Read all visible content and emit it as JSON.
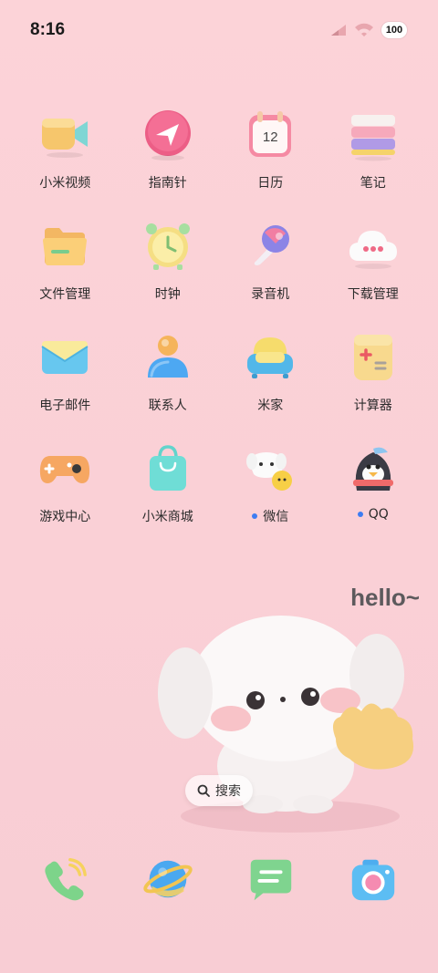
{
  "status": {
    "time": "8:16",
    "battery": "100"
  },
  "apps": [
    {
      "label": "小米视频",
      "icon": "video-icon"
    },
    {
      "label": "指南针",
      "icon": "compass-icon"
    },
    {
      "label": "日历",
      "icon": "calendar-icon",
      "calendar_day": "12"
    },
    {
      "label": "笔记",
      "icon": "notes-icon"
    },
    {
      "label": "文件管理",
      "icon": "folder-icon"
    },
    {
      "label": "时钟",
      "icon": "clock-icon"
    },
    {
      "label": "录音机",
      "icon": "microphone-icon"
    },
    {
      "label": "下载管理",
      "icon": "cloud-icon"
    },
    {
      "label": "电子邮件",
      "icon": "mail-icon"
    },
    {
      "label": "联系人",
      "icon": "contacts-icon"
    },
    {
      "label": "米家",
      "icon": "home-sofa-icon"
    },
    {
      "label": "计算器",
      "icon": "calculator-icon"
    },
    {
      "label": "游戏中心",
      "icon": "gamepad-icon"
    },
    {
      "label": "小米商城",
      "icon": "shopping-bag-icon"
    },
    {
      "label": "微信",
      "icon": "wechat-icon",
      "notification_dot": true
    },
    {
      "label": "QQ",
      "icon": "qq-penguin-icon",
      "notification_dot": true
    }
  ],
  "widget": {
    "hello_text": "hello~",
    "search_label": "搜索"
  },
  "dock": [
    {
      "icon": "phone-icon"
    },
    {
      "icon": "browser-planet-icon"
    },
    {
      "icon": "messages-icon"
    },
    {
      "icon": "camera-icon"
    }
  ],
  "colors": {
    "background": "#fad0d6",
    "notification_dot": "#3d7cf2"
  }
}
